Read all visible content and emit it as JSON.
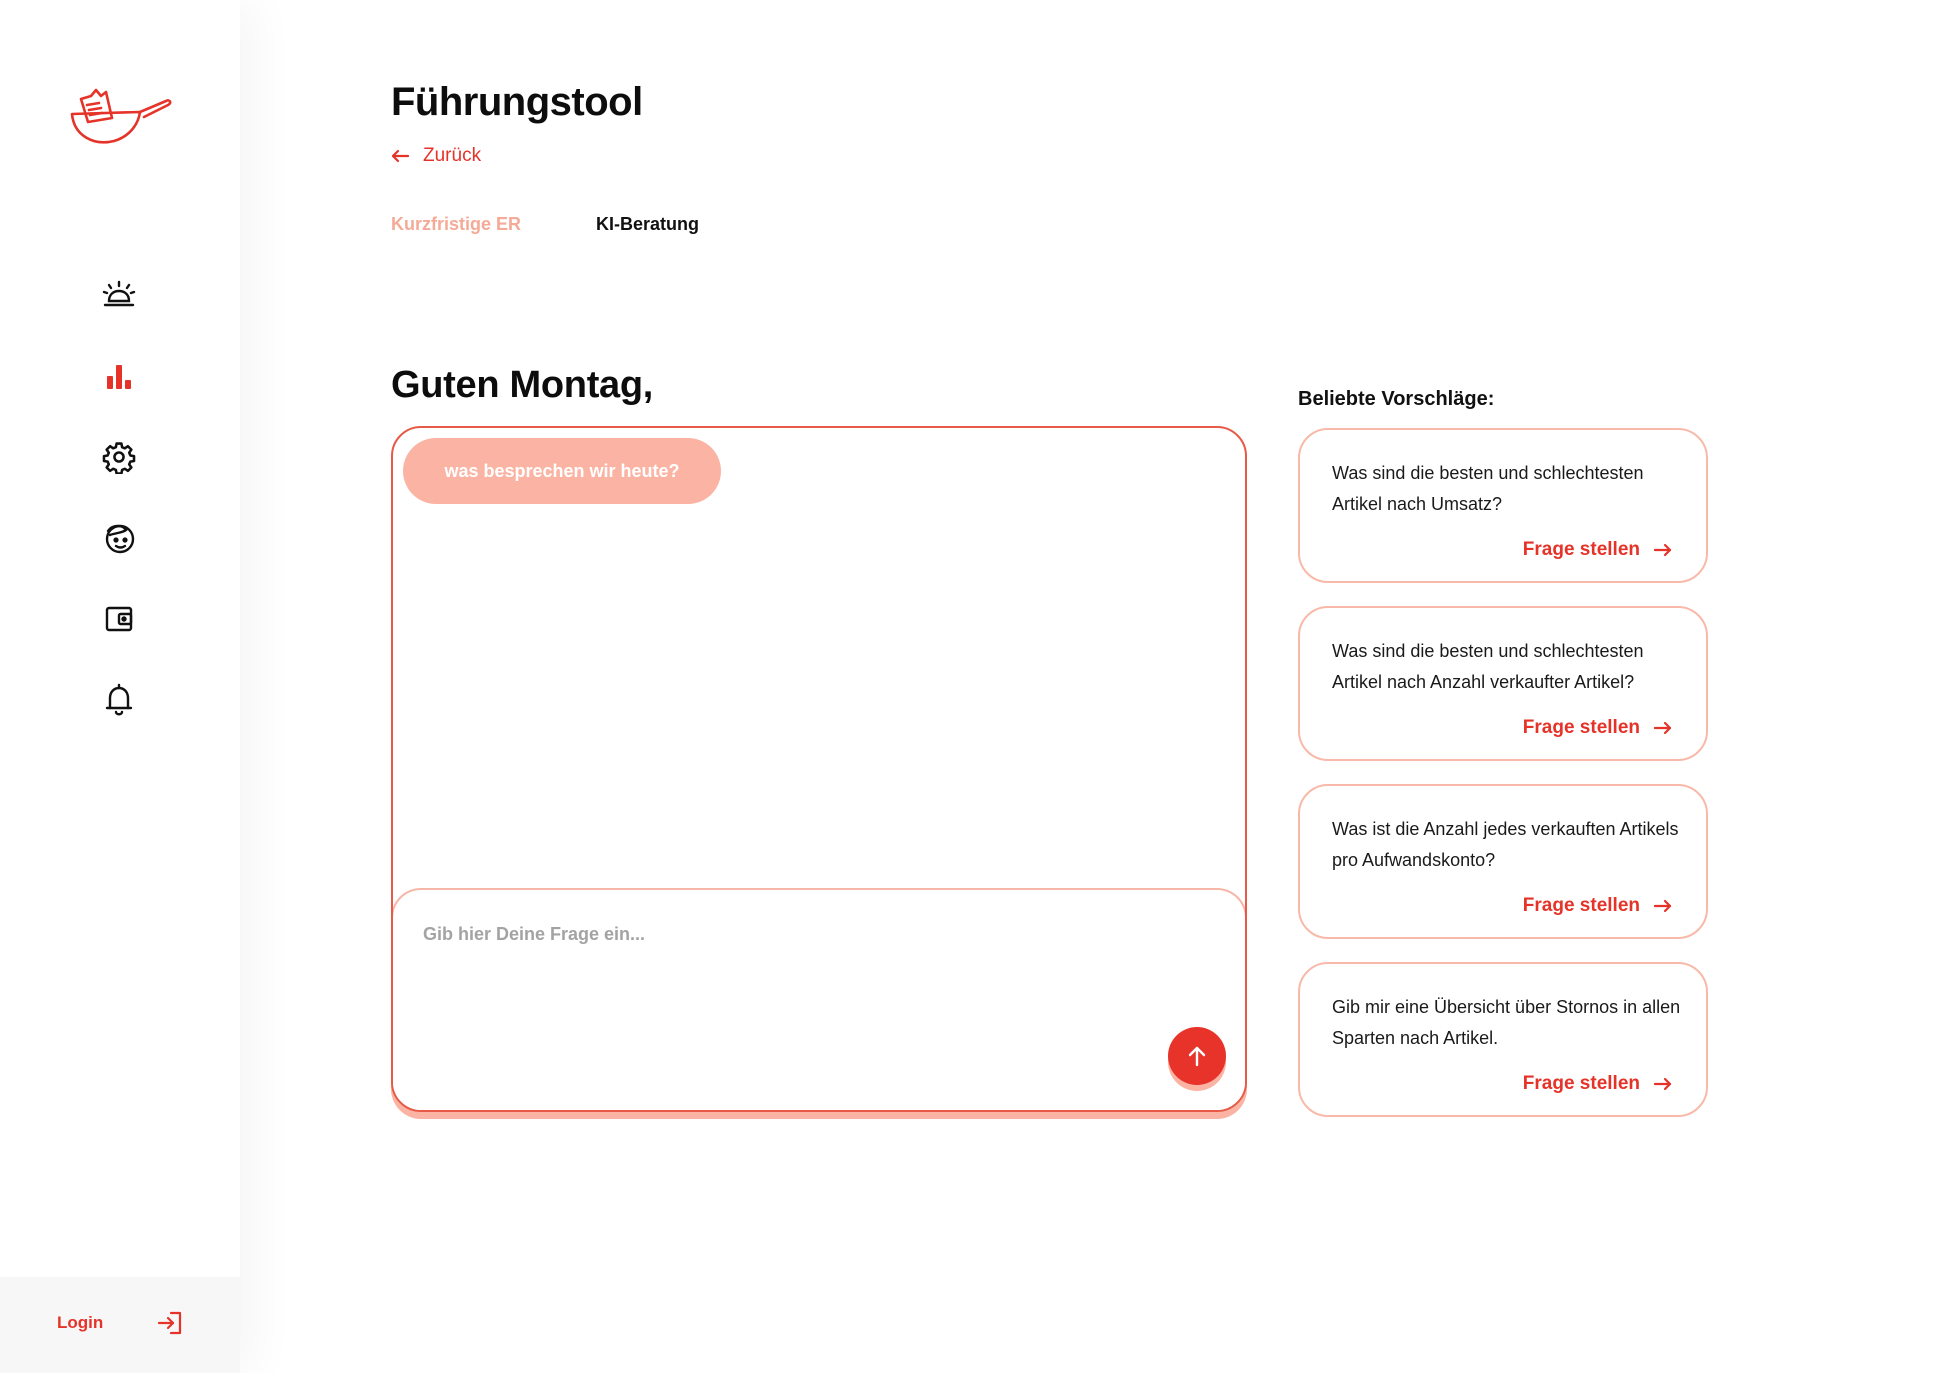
{
  "sidebar": {
    "logo": "logo-pan-receipt-icon",
    "nav_icons": [
      "cloche-service-icon",
      "bar-chart-icon",
      "gear-icon",
      "face-icon",
      "wallet-icon",
      "bell-icon"
    ],
    "login_label": "Login",
    "login_icon": "sign-in-icon"
  },
  "header": {
    "title": "Führungstool",
    "back_label": "Zurück",
    "tabs": [
      {
        "label": "Kurzfristige ER",
        "active": false
      },
      {
        "label": "KI-Beratung",
        "active": true
      }
    ]
  },
  "chat": {
    "greeting": "Guten Montag,",
    "bot_message": "was besprechen wir heute?",
    "input_placeholder": "Gib hier Deine Frage ein...",
    "input_value": "",
    "send_icon": "arrow-up-icon"
  },
  "suggestions": {
    "heading": "Beliebte Vorschläge:",
    "action_label": "Frage stellen",
    "items": [
      {
        "text": "Was sind die besten und schlechtesten Artikel nach Umsatz?"
      },
      {
        "text": "Was sind die besten und schlechtesten Artikel nach Anzahl verkaufter Artikel?"
      },
      {
        "text": "Was ist die Anzahl jedes verkauften Artikels pro Aufwandskonto?"
      },
      {
        "text": "Gib mir eine Übersicht über Stornos in allen Sparten nach Artikel."
      }
    ]
  },
  "colors": {
    "accent": "#e63329",
    "accent_light": "#fbb4a3",
    "tab_inactive": "#f5aa97",
    "text": "#111111",
    "placeholder": "#a3a3a3"
  }
}
